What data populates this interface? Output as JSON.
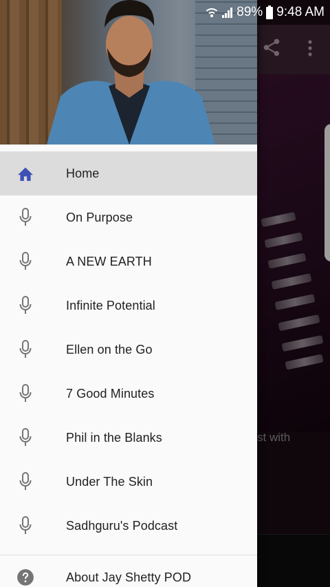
{
  "status_bar": {
    "battery": "89%",
    "time": "9:48 AM",
    "icons": [
      "wifi-icon",
      "signal-icon",
      "battery-icon"
    ]
  },
  "background": {
    "partial_text": "st with"
  },
  "drawer": {
    "menu": [
      {
        "label": "Home",
        "icon": "home-icon",
        "active": true
      },
      {
        "label": "On Purpose",
        "icon": "mic-icon"
      },
      {
        "label": "A NEW EARTH",
        "icon": "mic-icon"
      },
      {
        "label": "Infinite Potential",
        "icon": "mic-icon"
      },
      {
        "label": "Ellen on the Go",
        "icon": "mic-icon"
      },
      {
        "label": "7 Good Minutes",
        "icon": "mic-icon"
      },
      {
        "label": "Phil in the Blanks",
        "icon": "mic-icon"
      },
      {
        "label": "Under The Skin",
        "icon": "mic-icon"
      },
      {
        "label": "Sadhguru's Podcast",
        "icon": "mic-icon"
      }
    ],
    "about": {
      "label": "About Jay Shetty POD",
      "icon": "help-icon"
    }
  },
  "colors": {
    "active_icon": "#3f51b5",
    "icon_gray": "#757575",
    "active_row": "#dcdcdc"
  }
}
